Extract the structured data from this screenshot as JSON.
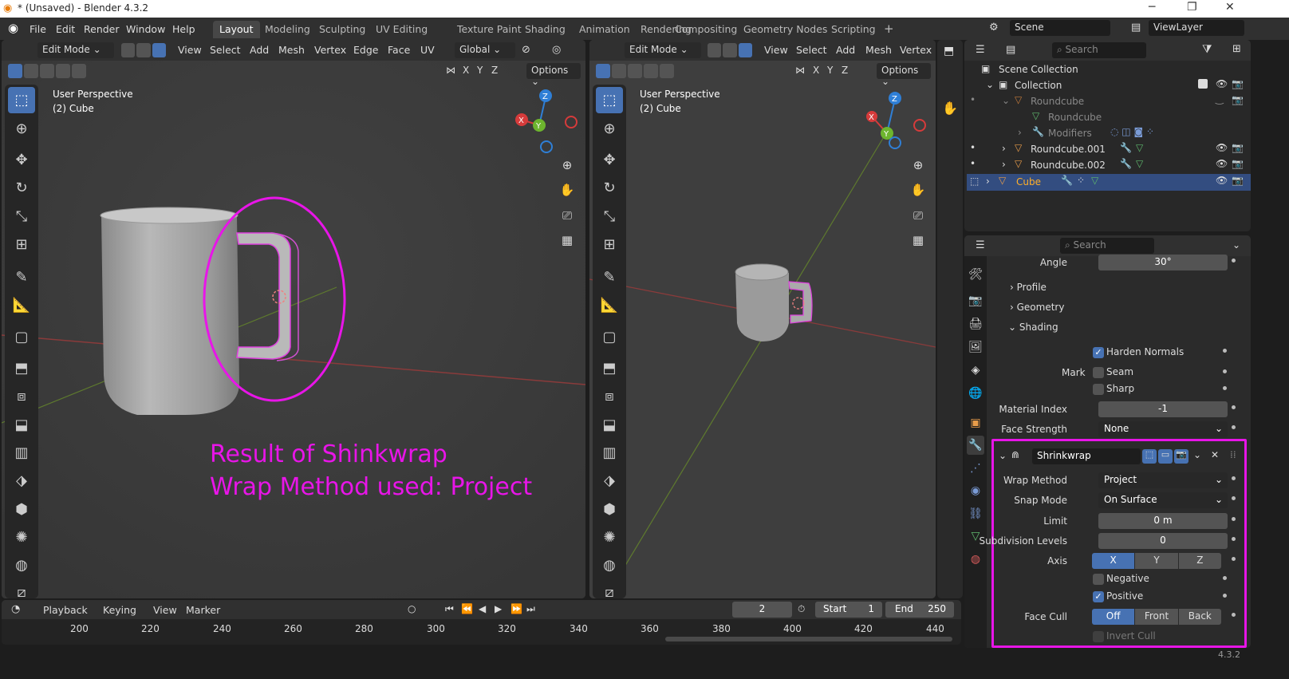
{
  "window": {
    "title": "* (Unsaved) - Blender 4.3.2",
    "minimize": "─",
    "maximize": "❐",
    "close": "✕"
  },
  "menu": [
    "File",
    "Edit",
    "Render",
    "Window",
    "Help"
  ],
  "workspaces": [
    "Layout",
    "Modeling",
    "Sculpting",
    "UV Editing",
    "Texture Paint",
    "Shading",
    "Animation",
    "Rendering",
    "Compositing",
    "Geometry Nodes",
    "Scripting"
  ],
  "workspace_add": "+",
  "scene": "Scene",
  "view_layer": "ViewLayer",
  "viewport_left": {
    "mode": "Edit Mode",
    "menus": [
      "View",
      "Select",
      "Add",
      "Mesh",
      "Vertex",
      "Edge",
      "Face",
      "UV"
    ],
    "transform": "Global",
    "axes": [
      "X",
      "Y",
      "Z"
    ],
    "options": "Options",
    "perspective": "User Perspective",
    "object": "(2) Cube"
  },
  "viewport_right": {
    "mode": "Edit Mode",
    "menus": [
      "View",
      "Select",
      "Add",
      "Mesh",
      "Vertex"
    ],
    "axes": [
      "X",
      "Y",
      "Z"
    ],
    "options": "Options",
    "perspective": "User Perspective",
    "object": "(2) Cube"
  },
  "gizmo": {
    "x": "X",
    "y": "Y",
    "z": "Z"
  },
  "annotation": {
    "line1": "Result of Shinkwrap",
    "line2": "Wrap Method used: Project",
    "color": "#e815e8"
  },
  "outliner": {
    "search_placeholder": "Search",
    "scene_collection": "Scene Collection",
    "collection": "Collection",
    "items": [
      "Roundcube",
      "Roundcube",
      "Modifiers",
      "Roundcube.001",
      "Roundcube.002",
      "Cube"
    ]
  },
  "properties": {
    "search_placeholder": "Search",
    "angle_label": "Angle",
    "angle": "30°",
    "profile": "Profile",
    "geometry": "Geometry",
    "shading": "Shading",
    "harden_normals": "Harden Normals",
    "mark": "Mark",
    "seam": "Seam",
    "sharp": "Sharp",
    "material_index_label": "Material Index",
    "material_index": "-1",
    "face_strength_label": "Face Strength",
    "face_strength": "None",
    "modifier_name": "Shrinkwrap",
    "wrap_method_label": "Wrap Method",
    "wrap_method": "Project",
    "snap_mode_label": "Snap Mode",
    "snap_mode": "On Surface",
    "limit_label": "Limit",
    "limit": "0 m",
    "subdiv_label": "Subdivision Levels",
    "subdiv": "0",
    "axis_label": "Axis",
    "axis": [
      "X",
      "Y",
      "Z"
    ],
    "negative": "Negative",
    "positive": "Positive",
    "face_cull_label": "Face Cull",
    "face_cull": [
      "Off",
      "Front",
      "Back"
    ],
    "invert_cull": "Invert Cull"
  },
  "timeline": {
    "menus": [
      "Playback",
      "Keying",
      "View",
      "Marker"
    ],
    "frame": "2",
    "start_label": "Start",
    "start": "1",
    "end_label": "End",
    "end": "250",
    "ticks": [
      "200",
      "220",
      "240",
      "260",
      "280",
      "300",
      "320",
      "340",
      "360",
      "380",
      "400",
      "420",
      "440"
    ]
  },
  "version": "4.3.2"
}
